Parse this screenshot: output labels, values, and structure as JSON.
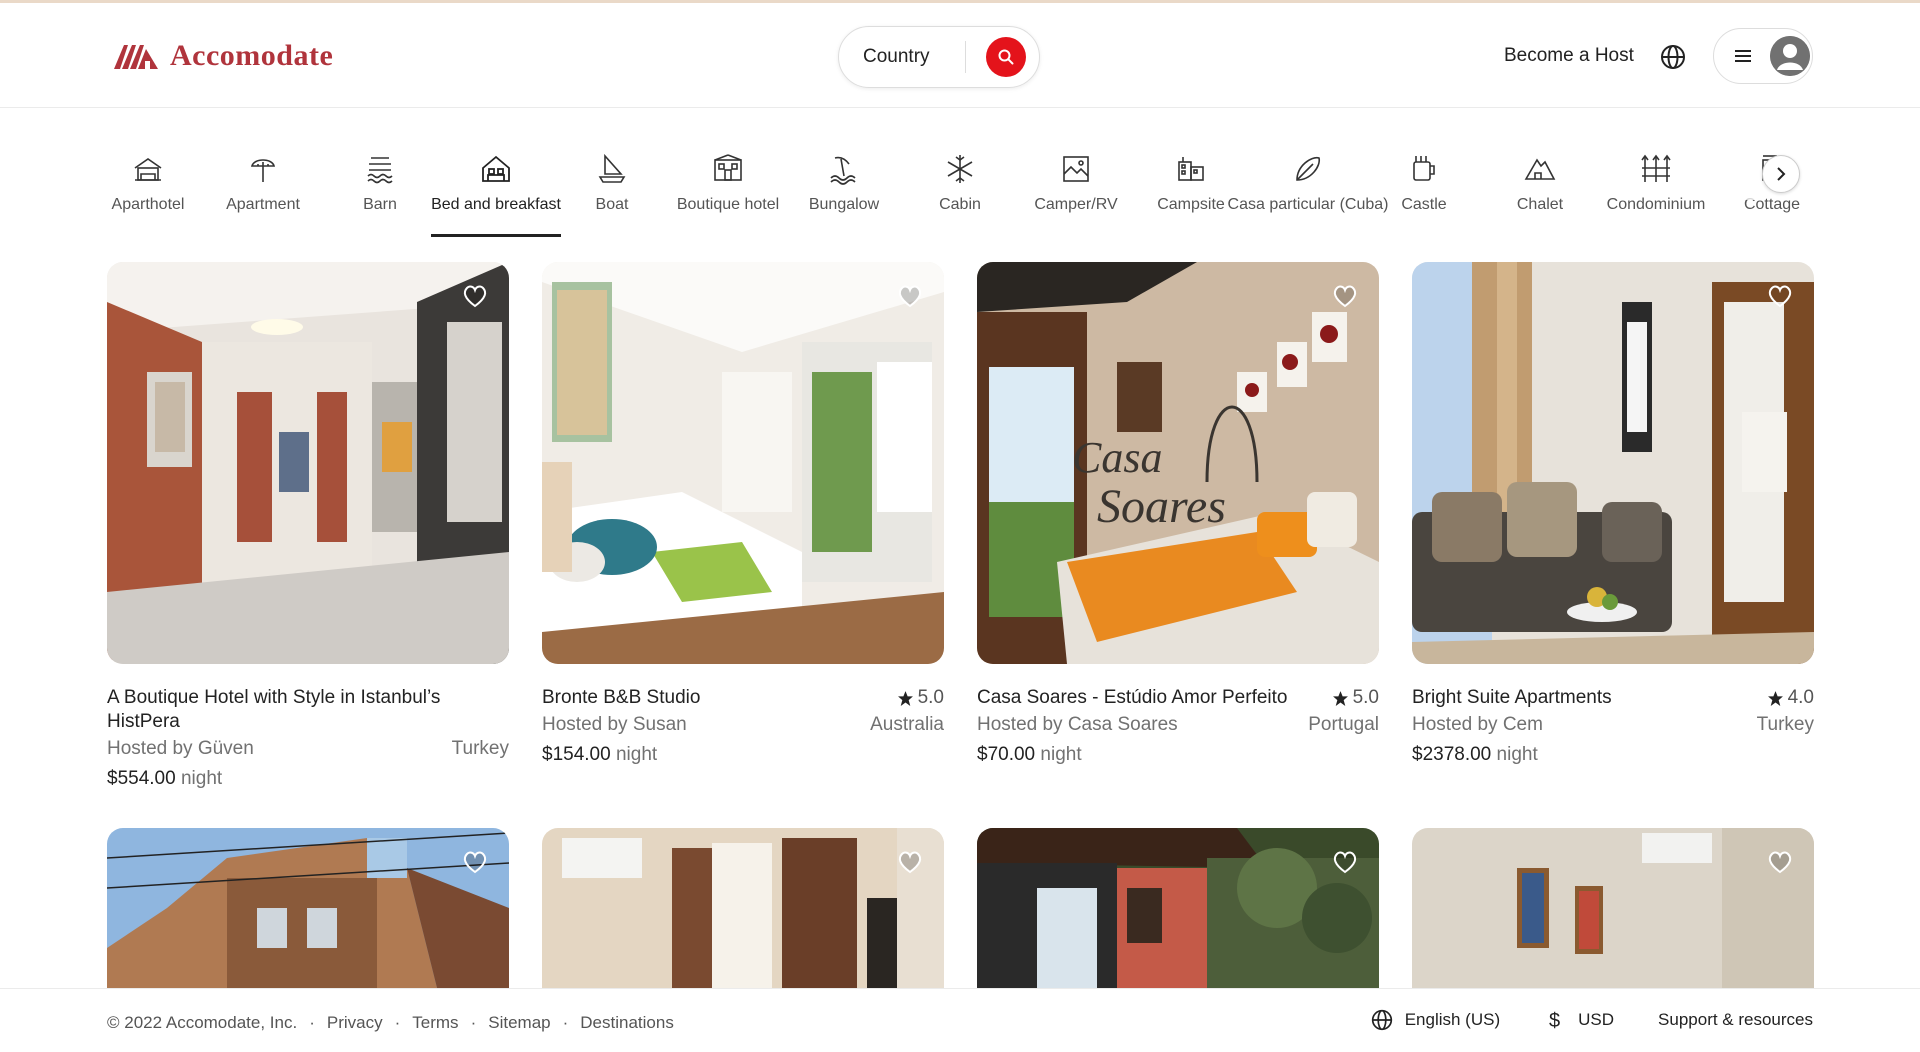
{
  "header": {
    "logo_text": "Accomodate",
    "search_label": "Country",
    "host_link": "Become a Host"
  },
  "categories": [
    {
      "label": "Aparthotel",
      "icon": "aparthotel-icon"
    },
    {
      "label": "Apartment",
      "icon": "apartment-icon"
    },
    {
      "label": "Barn",
      "icon": "barn-icon"
    },
    {
      "label": "Bed and breakfast",
      "icon": "bed-and-breakfast-icon",
      "active": true
    },
    {
      "label": "Boat",
      "icon": "boat-icon"
    },
    {
      "label": "Boutique hotel",
      "icon": "boutique-hotel-icon"
    },
    {
      "label": "Bungalow",
      "icon": "bungalow-icon"
    },
    {
      "label": "Cabin",
      "icon": "cabin-icon"
    },
    {
      "label": "Camper/RV",
      "icon": "camper-icon"
    },
    {
      "label": "Campsite",
      "icon": "campsite-icon"
    },
    {
      "label": "Casa particular (Cuba)",
      "icon": "casa-particular-icon"
    },
    {
      "label": "Castle",
      "icon": "castle-icon"
    },
    {
      "label": "Chalet",
      "icon": "chalet-icon"
    },
    {
      "label": "Condominium",
      "icon": "condominium-icon"
    },
    {
      "label": "Cottage",
      "icon": "cottage-icon"
    }
  ],
  "listings": [
    {
      "title": "A Boutique Hotel with Style in Istanbul’s HistPera",
      "rating": "",
      "host": "Hosted by Güven",
      "country": "Turkey",
      "price": "$554.00",
      "unit": "night"
    },
    {
      "title": "Bronte B&B Studio",
      "rating": "5.0",
      "host": "Hosted by Susan",
      "country": "Australia",
      "price": "$154.00",
      "unit": "night"
    },
    {
      "title": "Casa Soares - Estúdio Amor Perfeito",
      "rating": "5.0",
      "host": "Hosted by Casa Soares",
      "country": "Portugal",
      "price": "$70.00",
      "unit": "night"
    },
    {
      "title": "Bright Suite Apartments",
      "rating": "4.0",
      "host": "Hosted by Cem",
      "country": "Turkey",
      "price": "$2378.00",
      "unit": "night"
    }
  ],
  "footer": {
    "copyright": "© 2022 Accomodate, Inc.",
    "links": [
      "Privacy",
      "Terms",
      "Sitemap",
      "Destinations"
    ],
    "language": "English (US)",
    "currency": "USD",
    "support": "Support & resources"
  },
  "colors": {
    "brand": "#b0343c",
    "search_button": "#e4131b"
  }
}
